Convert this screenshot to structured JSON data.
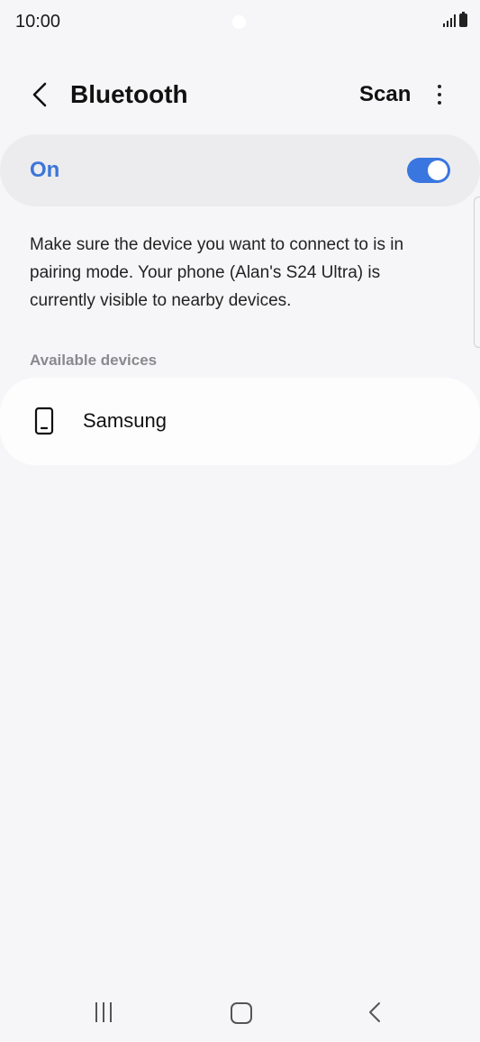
{
  "status_bar": {
    "time": "10:00"
  },
  "header": {
    "title": "Bluetooth",
    "scan_label": "Scan",
    "back_icon": "chevron-left-icon",
    "more_icon": "more-vertical-icon"
  },
  "toggle": {
    "label": "On",
    "state": "on"
  },
  "description": "Make sure the device you want to connect to is in pairing mode. Your phone (Alan's S24 Ultra) is currently visible to nearby devices.",
  "available_devices": {
    "title": "Available devices",
    "items": [
      {
        "name": "Samsung",
        "icon": "smartphone-icon"
      }
    ]
  },
  "nav_bar": {
    "recents_icon": "recents-icon",
    "home_icon": "home-icon",
    "back_icon": "back-icon"
  },
  "colors": {
    "accent": "#3a76e0",
    "toggle_label": "#3d75d8",
    "background": "#f6f6f8",
    "card": "#ececef"
  }
}
